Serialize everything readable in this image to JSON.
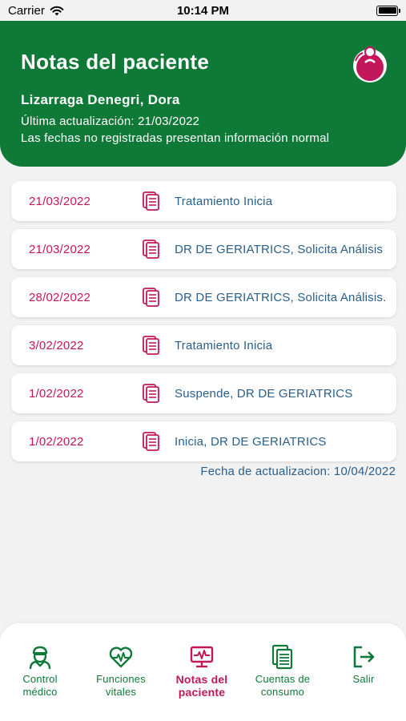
{
  "status_bar": {
    "carrier": "Carrier",
    "time": "10:14 PM"
  },
  "header": {
    "title": "Notas del paciente",
    "patient_name": "Lizarraga Denegri, Dora",
    "last_update": "Última actualización: 21/03/2022",
    "info_note": "Las fechas no registradas presentan información normal"
  },
  "notes": [
    {
      "date": "21/03/2022",
      "text": "Tratamiento Inicia"
    },
    {
      "date": "21/03/2022",
      "text": "DR DE GERIATRICS, Solicita Análisis"
    },
    {
      "date": "28/02/2022",
      "text": "DR DE GERIATRICS, Solicita Análisis."
    },
    {
      "date": "3/02/2022",
      "text": "Tratamiento Inicia"
    },
    {
      "date": "1/02/2022",
      "text": "Suspende, DR DE GERIATRICS"
    },
    {
      "date": "1/02/2022",
      "text": "Inicia, DR DE GERIATRICS"
    }
  ],
  "footer_update": "Fecha de actualizacion: 10/04/2022",
  "tabs": [
    {
      "line1": "Control",
      "line2": "médico",
      "icon": "doctor-icon"
    },
    {
      "line1": "Funciones",
      "line2": "vitales",
      "icon": "heart-pulse-icon"
    },
    {
      "line1": "Notas del",
      "line2": "paciente",
      "icon": "monitor-icon",
      "active": true
    },
    {
      "line1": "Cuentas de",
      "line2": "consumo",
      "icon": "documents-icon"
    },
    {
      "line1": "Salir",
      "line2": "",
      "icon": "logout-icon"
    }
  ],
  "colors": {
    "brand_green": "#0f7a37",
    "accent_magenta": "#c2185b",
    "text_blue": "#2a5f8a",
    "background": "#f2f2f2"
  }
}
